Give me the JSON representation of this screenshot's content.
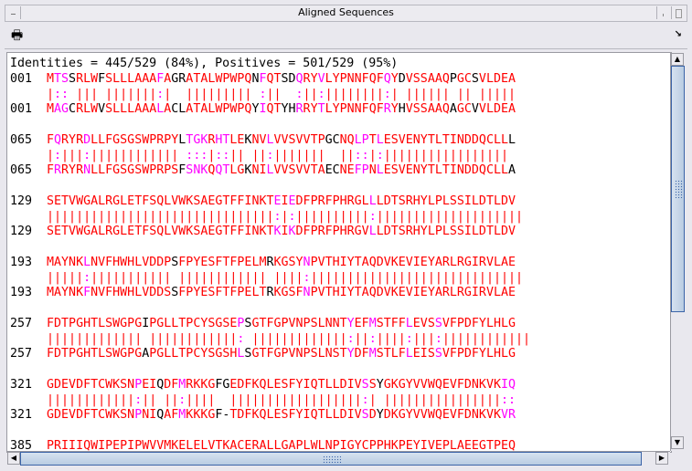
{
  "window": {
    "title": "Aligned Sequences"
  },
  "toolbar": {
    "print_icon": "printer-icon",
    "undock_icon": "arrow-down-right-icon"
  },
  "colors": {
    "identity": "#ff0000",
    "positive": "#ff00ff",
    "mismatch": "#000000"
  },
  "summary": "Identities = 445/529 (84%), Positives = 501/529 (95%)",
  "blocks": [
    {
      "pos": "001",
      "query": "MTSSRLWFSLLLAAAFAGRATALWPWPQNFQTSDQRYVLYPNNFQFQYDVSSAAQPGCSVLDEA",
      "match": "|:: ||| |||||||:|  ||||||||| :||  :||:||||||||:| |||||| || |||||",
      "subject": "MAGCRLWVSLLLAAALACLATALWPWPQYIQTYHRRYTLYPNNFQFRYHVSSAAQAGCVVLDEA"
    },
    {
      "pos": "065",
      "query": "FQRYRDLLFGSGSWPRPYLTGKRHTLEKNVLVVSVVTPGCNQLPTLESVENYTLTINDDQCLLL",
      "match": "|:|||:|||||||||||| :::|::|| ||:|||||||  ||::|:||||||||||||||||| ",
      "subject": "FRRYRNLLFGSGSWPRPSFSNKQQTLGKNILVVSVVTAECNEFPNLESVENYTLTINDDQCLLA"
    },
    {
      "pos": "129",
      "query": "SETVWGALRGLETFSQLVWKSAEGTFFINKTEIEDFPRFPHRGLLLDTSRHYLPLSSILDTLDV",
      "match": "|||||||||||||||||||||||||||||||:|:||||||||||:||||||||||||||||||||",
      "subject": "SETVWGALRGLETFSQLVWKSAEGTFFINKTKIKDFPRFPHRGVLLDTSRHYLPLSSILDTLDV"
    },
    {
      "pos": "193",
      "query": "MAYNKLNVFHWHLVDDPSFPYESFTFPELMRKGSYNPVTHIYTAQDVKEVIEYARLRGIRVLAE",
      "match": "|||||:||||||||||| |||||||||||| ||||:|||||||||||||||||||||||||||||",
      "subject": "MAYNKFNVFHWHLVDDSSFPYESFTFPELTRKGSFNPVTHIYTAQDVKEVIEYARLRGIRVLAE"
    },
    {
      "pos": "257",
      "query": "FDTPGHTLSWGPGIPGLLTPCYSGSEPSGTFGPVNPSLNNTYEFMSTFFLEVSSVFPDFYLHLG",
      "match": "||||||||||||| ||||||||||||: |||||||||||||:||:||||:|||:||||||||||||",
      "subject": "FDTPGHTLSWGPGAPGLLTPCYSGSHLSGTFGPVNPSLNSTYDFMSTLFLEISSVFPDFYLHLG"
    },
    {
      "pos": "321",
      "query": "GDEVDFTCWKSNPEIQDFMRKKGFGEDFKQLESFYIQTLLDIVSSYGKGYVVWQEVFDNKVKIQ",
      "match": "||||||||||||:|| ||:||||  ||||||||||||||||||:| ||||||||||||||||::",
      "subject": "GDEVDFTCWKSNPNIQAFMKKKGF-TDFKQLESFYIQTLLDIVSDYDKGYVVWQEVFDNKVKVR"
    },
    {
      "pos": "385",
      "query": "PRIIIQWIPEPIPWVVMKELELVTKACERALLGAPLWLNPIGYCPPHKPEYIVEPLAEEGTPEQ",
      "match": "",
      "subject": ""
    }
  ]
}
